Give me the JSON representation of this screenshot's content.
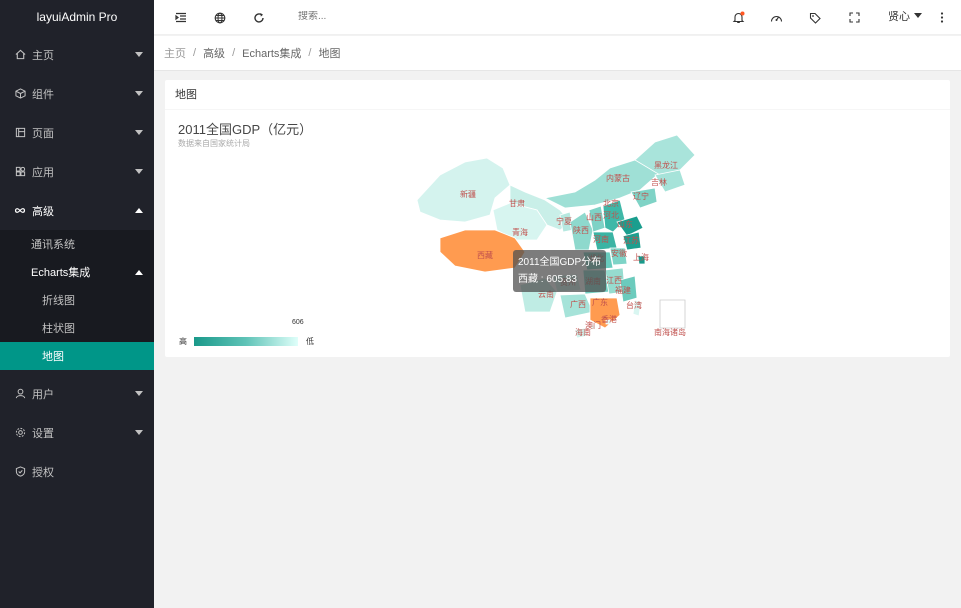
{
  "app": {
    "title": "layuiAdmin Pro"
  },
  "sidebar": {
    "items": [
      {
        "label": "主页"
      },
      {
        "label": "组件"
      },
      {
        "label": "页面"
      },
      {
        "label": "应用"
      },
      {
        "label": "高级"
      },
      {
        "label": "用户"
      },
      {
        "label": "设置"
      },
      {
        "label": "授权"
      }
    ],
    "advanced": {
      "sub1": "通讯系统",
      "sub2": "Echarts集成",
      "children": [
        "折线图",
        "柱状图",
        "地图"
      ]
    }
  },
  "topbar": {
    "search_placeholder": "搜索...",
    "user": "贤心"
  },
  "breadcrumb": [
    "主页",
    "高级",
    "Echarts集成",
    "地图"
  ],
  "card": {
    "title": "地图"
  },
  "chart_data": {
    "type": "map",
    "title": "2011全国GDP（亿元）",
    "subtitle": "数据来自国家统计局",
    "series_name": "2011全国GDP分布",
    "visual_map": {
      "max": 606,
      "max_label": "606",
      "high_label": "高",
      "low_label": "低"
    },
    "regions": [
      {
        "name": "新疆"
      },
      {
        "name": "甘肃"
      },
      {
        "name": "青海"
      },
      {
        "name": "西藏",
        "value": 605.83
      },
      {
        "name": "宁夏"
      },
      {
        "name": "陕西"
      },
      {
        "name": "山西"
      },
      {
        "name": "内蒙古"
      },
      {
        "name": "黑龙江"
      },
      {
        "name": "吉林"
      },
      {
        "name": "辽宁"
      },
      {
        "name": "北京"
      },
      {
        "name": "河北"
      },
      {
        "name": "山东"
      },
      {
        "name": "河南"
      },
      {
        "name": "江苏"
      },
      {
        "name": "安徽"
      },
      {
        "name": "上海"
      },
      {
        "name": "湖北"
      },
      {
        "name": "贵州"
      },
      {
        "name": "湖南"
      },
      {
        "name": "江西"
      },
      {
        "name": "福建"
      },
      {
        "name": "云南"
      },
      {
        "name": "广西"
      },
      {
        "name": "广东"
      },
      {
        "name": "台湾"
      },
      {
        "name": "澳门"
      },
      {
        "name": "香港"
      },
      {
        "name": "海南"
      },
      {
        "name": "南海诸岛"
      }
    ],
    "tooltip": {
      "title": "2011全国GDP分布",
      "label": "西藏 : 605.83"
    }
  },
  "colors": {
    "accent": "#009688",
    "highlight": "#ff9f55",
    "label": "#c0504d"
  }
}
